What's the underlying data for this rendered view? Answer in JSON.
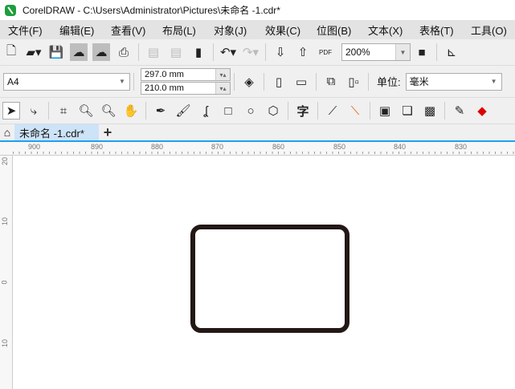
{
  "title": "CorelDRAW - C:\\Users\\Administrator\\Pictures\\未命名 -1.cdr*",
  "menu": [
    "文件(F)",
    "编辑(E)",
    "查看(V)",
    "布局(L)",
    "对象(J)",
    "效果(C)",
    "位图(B)",
    "文本(X)",
    "表格(T)",
    "工具(O)"
  ],
  "toolbar": {
    "zoom": "200%",
    "pdf": "PDF"
  },
  "property": {
    "page_size": "A4",
    "width": "297.0 mm",
    "height": "210.0 mm",
    "unit_label": "单位:",
    "unit": "毫米"
  },
  "toolbox": {
    "text_tool": "字"
  },
  "tab": {
    "label": "未命名 -1.cdr*",
    "add": "+"
  },
  "ruler": {
    "h": [
      "900",
      "890",
      "880",
      "870",
      "860",
      "850",
      "840",
      "830"
    ],
    "v": [
      "20",
      "10",
      "0",
      "10"
    ]
  },
  "colors": {
    "shape_stroke": "#231815",
    "tab_accent": "#1ea0f0"
  }
}
